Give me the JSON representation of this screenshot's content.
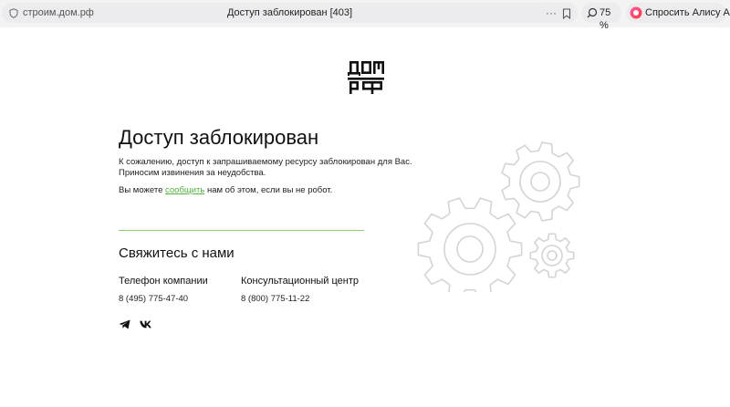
{
  "browser": {
    "domain": "строим.дом.рф",
    "tab_title": "Доступ заблокирован [403]",
    "menu_dots": "···",
    "zoom": "75 %",
    "alice_label": "Спросить Алису AI"
  },
  "page": {
    "title": "Доступ заблокирован",
    "intro": "К сожалению, доступ к запрашиваемому ресурсу заблокирован для Вас. Приносим извинения за неудобства.",
    "report_prefix": "Вы можете ",
    "report_link": "сообщить",
    "report_suffix": " нам об этом, если вы не робот.",
    "contact_title": "Свяжитесь с нами",
    "contacts": [
      {
        "label": "Телефон компании",
        "phone": "8 (495) 775-47-40"
      },
      {
        "label": "Консультационный центр",
        "phone": "8 (800) 775-11-22"
      }
    ],
    "social": [
      "telegram-icon",
      "vk-icon"
    ]
  },
  "colors": {
    "accent_green": "#56b23f",
    "divider_green": "#8dc97b",
    "gear_stroke": "#d4d4d4"
  }
}
